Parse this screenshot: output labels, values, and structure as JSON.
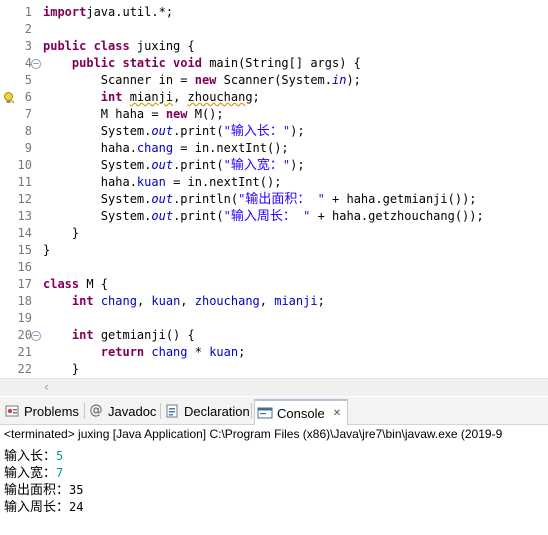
{
  "editor": {
    "lines": [
      {
        "n": "1",
        "t": [
          [
            "kw",
            "import"
          ],
          [
            "",
            "java.util.*;"
          ]
        ]
      },
      {
        "n": "2",
        "t": []
      },
      {
        "n": "3",
        "t": [
          [
            "kw",
            "public class "
          ],
          [
            "",
            "juxing {"
          ]
        ]
      },
      {
        "n": "4",
        "t": [
          [
            "",
            "    "
          ],
          [
            "kw",
            "public static void "
          ],
          [
            "",
            "main(String[] args) {"
          ]
        ]
      },
      {
        "n": "5",
        "t": [
          [
            "",
            "        Scanner in = "
          ],
          [
            "kw",
            "new "
          ],
          [
            "",
            "Scanner(System."
          ],
          [
            "st",
            "in"
          ],
          [
            "",
            ");"
          ]
        ]
      },
      {
        "n": "6",
        "t": [
          [
            "",
            "        "
          ],
          [
            "kw",
            "int "
          ],
          [
            "squig",
            "mianji"
          ],
          [
            "",
            ", "
          ],
          [
            "squig",
            "zhouchang"
          ],
          [
            "",
            ";"
          ]
        ]
      },
      {
        "n": "7",
        "t": [
          [
            "",
            "        M haha = "
          ],
          [
            "kw",
            "new "
          ],
          [
            "",
            "M();"
          ]
        ]
      },
      {
        "n": "8",
        "t": [
          [
            "",
            "        System."
          ],
          [
            "st",
            "out"
          ],
          [
            "",
            ".print("
          ],
          [
            "str",
            "\""
          ],
          [
            "strcjk",
            "输入长："
          ],
          [
            "str",
            "\""
          ],
          [
            "",
            ");"
          ]
        ]
      },
      {
        "n": "9",
        "t": [
          [
            "",
            "        haha."
          ],
          [
            "fld",
            "chang"
          ],
          [
            "",
            "",
            " "
          ],
          [
            "",
            "= in.nextInt();"
          ]
        ]
      },
      {
        "n": "10",
        "t": [
          [
            "",
            "        System."
          ],
          [
            "st",
            "out"
          ],
          [
            "",
            ".print("
          ],
          [
            "str",
            "\""
          ],
          [
            "strcjk",
            "输入宽："
          ],
          [
            "str",
            "\""
          ],
          [
            "",
            ");"
          ]
        ]
      },
      {
        "n": "11",
        "t": [
          [
            "",
            "        haha."
          ],
          [
            "fld",
            "kuan"
          ],
          [
            "",
            "",
            " "
          ],
          [
            "",
            "= in.nextInt();"
          ]
        ]
      },
      {
        "n": "12",
        "t": [
          [
            "",
            "        System."
          ],
          [
            "st",
            "out"
          ],
          [
            "",
            ".println("
          ],
          [
            "str",
            "\""
          ],
          [
            "strcjk",
            "输出面积："
          ],
          [
            "str",
            " \""
          ],
          [
            "",
            " + haha.getmianji());"
          ]
        ]
      },
      {
        "n": "13",
        "t": [
          [
            "",
            "        System."
          ],
          [
            "st",
            "out"
          ],
          [
            "",
            ".print("
          ],
          [
            "str",
            "\""
          ],
          [
            "strcjk",
            "输入周长："
          ],
          [
            "str",
            " \""
          ],
          [
            "",
            " + haha.getzhouchang());"
          ]
        ]
      },
      {
        "n": "14",
        "t": [
          [
            "",
            "    }"
          ]
        ]
      },
      {
        "n": "15",
        "t": [
          [
            "",
            "}"
          ]
        ]
      },
      {
        "n": "16",
        "t": []
      },
      {
        "n": "17",
        "t": [
          [
            "kw",
            "class "
          ],
          [
            "",
            "M {"
          ]
        ]
      },
      {
        "n": "18",
        "t": [
          [
            "",
            "    "
          ],
          [
            "kw",
            "int "
          ],
          [
            "fld",
            "chang"
          ],
          [
            "",
            ", "
          ],
          [
            "fld",
            "kuan"
          ],
          [
            "",
            ", "
          ],
          [
            "fld",
            "zhouchang"
          ],
          [
            "",
            ", "
          ],
          [
            "fld",
            "mianji"
          ],
          [
            "",
            ";"
          ]
        ]
      },
      {
        "n": "19",
        "t": []
      },
      {
        "n": "20",
        "t": [
          [
            "",
            "    "
          ],
          [
            "kw",
            "int "
          ],
          [
            "",
            "getmianji() {"
          ]
        ]
      },
      {
        "n": "21",
        "t": [
          [
            "",
            "        "
          ],
          [
            "kw",
            "return "
          ],
          [
            "fld",
            "chang"
          ],
          [
            "",
            " * "
          ],
          [
            "fld",
            "kuan"
          ],
          [
            "",
            ";"
          ]
        ]
      },
      {
        "n": "22",
        "t": [
          [
            "",
            "    }"
          ]
        ]
      }
    ],
    "fold_lines": [
      "4",
      "20"
    ],
    "warning_line": "6"
  },
  "tabs": {
    "problems": "Problems",
    "javadoc": "Javadoc",
    "declaration": "Declaration",
    "console": "Console",
    "close_glyph": "✕"
  },
  "console": {
    "terminated": "<terminated> juxing [Java Application] C:\\Program Files (x86)\\Java\\jre7\\bin\\javaw.exe (2019-9",
    "output": [
      {
        "label": "输入长：",
        "value": "5",
        "input": true
      },
      {
        "label": "输入宽：",
        "value": "7",
        "input": true
      },
      {
        "label": "输出面积：",
        "value": "35",
        "input": false
      },
      {
        "label": "输入周长：",
        "value": "24",
        "input": false
      }
    ]
  },
  "colors": {
    "keyword": "#7f0055",
    "field": "#0000c0",
    "string": "#2a00ff",
    "user_input": "#00a0a0"
  }
}
